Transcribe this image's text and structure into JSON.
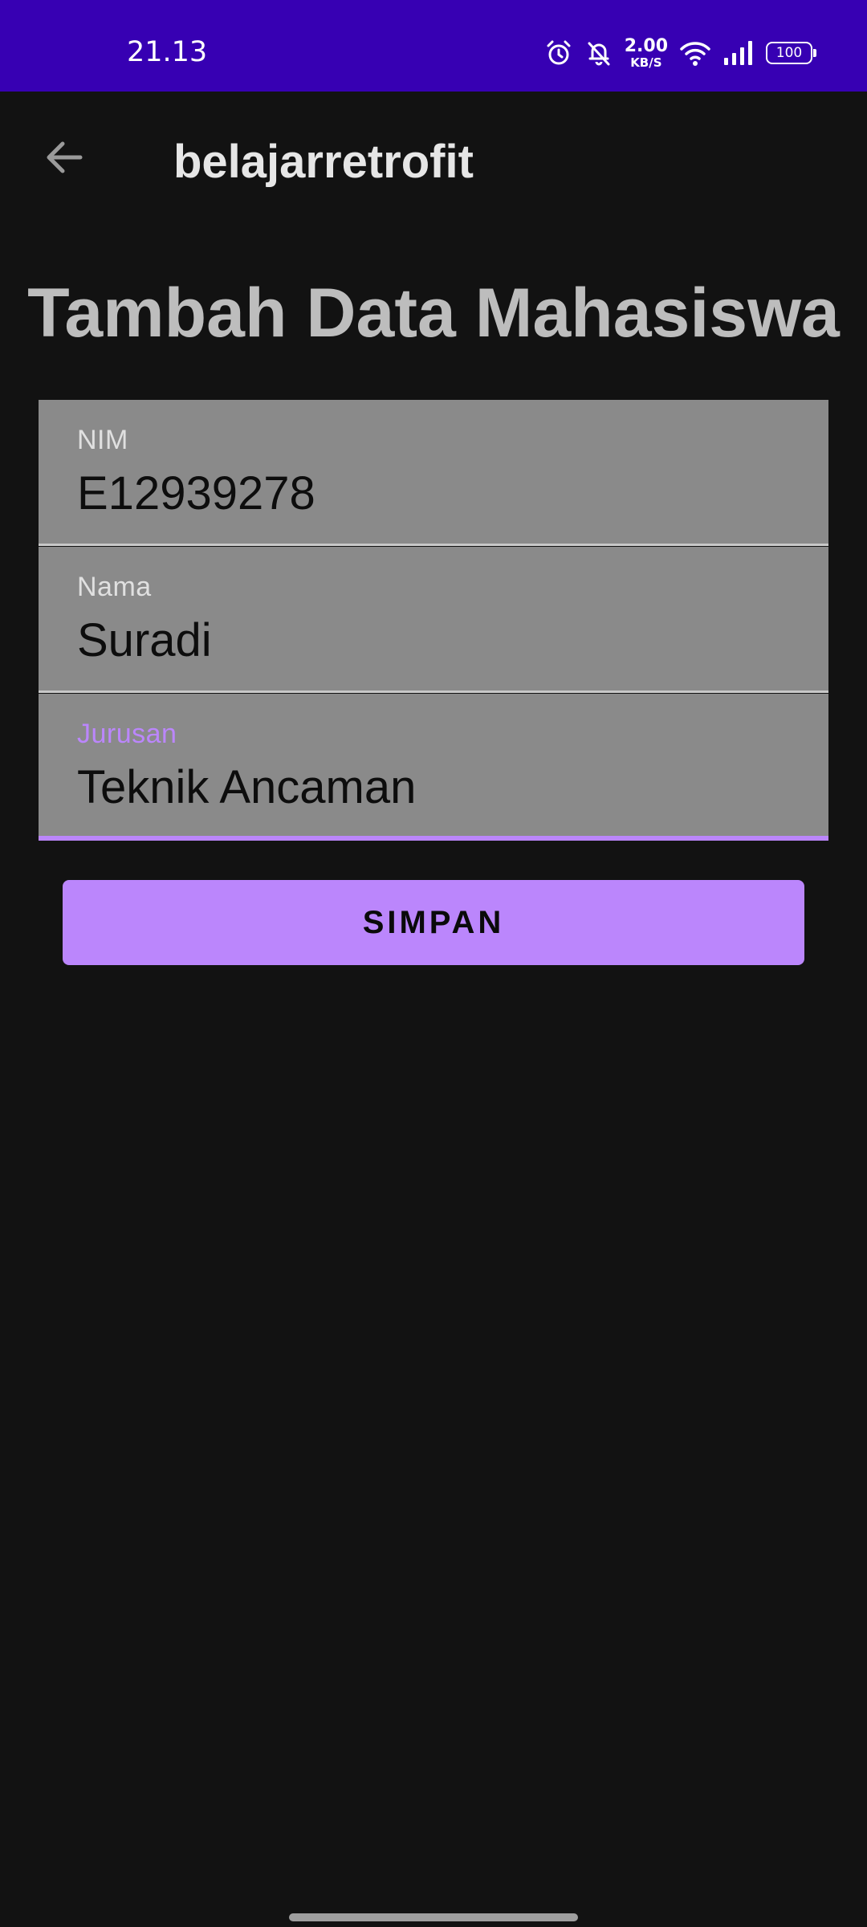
{
  "status_bar": {
    "time": "21.13",
    "net_speed_value": "2.00",
    "net_speed_unit": "KB/S",
    "battery_level": "100",
    "background_color": "#3700B3"
  },
  "app_bar": {
    "title": "belajarretrofit",
    "back_icon": "arrow-back-icon"
  },
  "page": {
    "heading": "Tambah Data Mahasiswa"
  },
  "form": {
    "nim": {
      "label": "NIM",
      "value": "E12939278"
    },
    "nama": {
      "label": "Nama",
      "value": "Suradi"
    },
    "jurusan": {
      "label": "Jurusan",
      "value": "Teknik Ancaman",
      "focused": true
    }
  },
  "actions": {
    "save_label": "SIMPAN"
  },
  "colors": {
    "accent": "#BB86FC",
    "background": "#121212",
    "field_background": "#8a8a8a"
  }
}
